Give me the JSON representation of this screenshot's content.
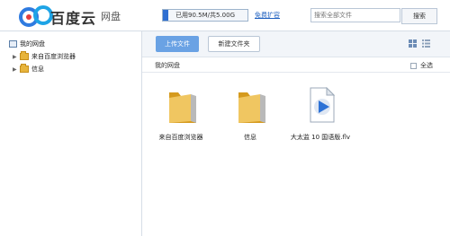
{
  "header": {
    "logo_text": "百度云",
    "logo_sub": "网盘",
    "quota_text": "已用90.5M/共5.00G",
    "quota_fraction": 0.018,
    "upgrade_link": "免费扩容",
    "search_placeholder": "搜索全部文件",
    "search_button": "搜索"
  },
  "sidebar": {
    "root": "我的网盘",
    "items": [
      {
        "label": "来自百度浏览器"
      },
      {
        "label": "信息"
      }
    ]
  },
  "toolbar": {
    "upload_label": "上传文件",
    "new_folder_label": "新建文件夹"
  },
  "pathbar": {
    "path": "我的网盘",
    "select_all": "全选"
  },
  "files": [
    {
      "name": "来自百度浏览器",
      "icon": "folder-icon"
    },
    {
      "name": "信息",
      "icon": "folder-icon"
    },
    {
      "name": "大太监 10 国语版.flv",
      "icon": "video-file-icon"
    }
  ],
  "colors": {
    "accent": "#6aa2e4",
    "link": "#1d5fbf",
    "folder": "#e7b43c"
  }
}
